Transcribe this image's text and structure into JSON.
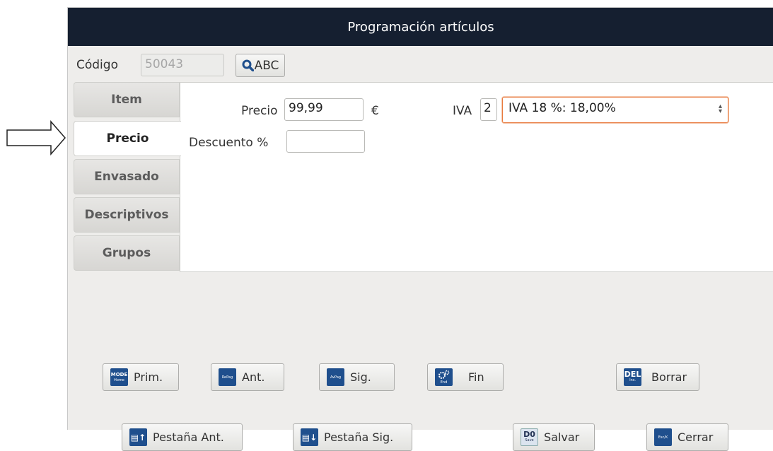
{
  "window": {
    "title": "Programación artículos"
  },
  "code": {
    "label": "Código",
    "value": "50043",
    "search_label": "ABC"
  },
  "tabs": [
    {
      "label": "Item"
    },
    {
      "label": "Precio"
    },
    {
      "label": "Envasado"
    },
    {
      "label": "Descriptivos"
    },
    {
      "label": "Grupos"
    }
  ],
  "price": {
    "precio_label": "Precio",
    "precio_value": "99,99",
    "currency": "€",
    "descuento_label": "Descuento %",
    "descuento_value": "",
    "iva_label": "IVA",
    "iva_code": "2",
    "iva_selected": "IVA 18 %: 18,00%"
  },
  "buttons": {
    "prim": {
      "label": "Prim.",
      "key": "MODE",
      "key_sub": "Home"
    },
    "ant": {
      "label": "Ant.",
      "key": "RePag"
    },
    "sig": {
      "label": "Sig.",
      "key": "AvPag"
    },
    "fin": {
      "label": "Fin",
      "key": "End"
    },
    "borrar": {
      "label": "Borrar",
      "key": "DEL",
      "key_sub": "Ins."
    },
    "pestana_ant": {
      "label": "Pestaña Ant."
    },
    "pestana_sig": {
      "label": "Pestaña Sig."
    },
    "salvar": {
      "label": "Salvar",
      "key": "D0",
      "key_sub": "Save"
    },
    "cerrar": {
      "label": "Cerrar",
      "key": "Esc/K"
    }
  },
  "colors": {
    "titlebar": "#151f30",
    "accent_focus": "#e87a3e",
    "key_icon": "#1f4f8d"
  }
}
